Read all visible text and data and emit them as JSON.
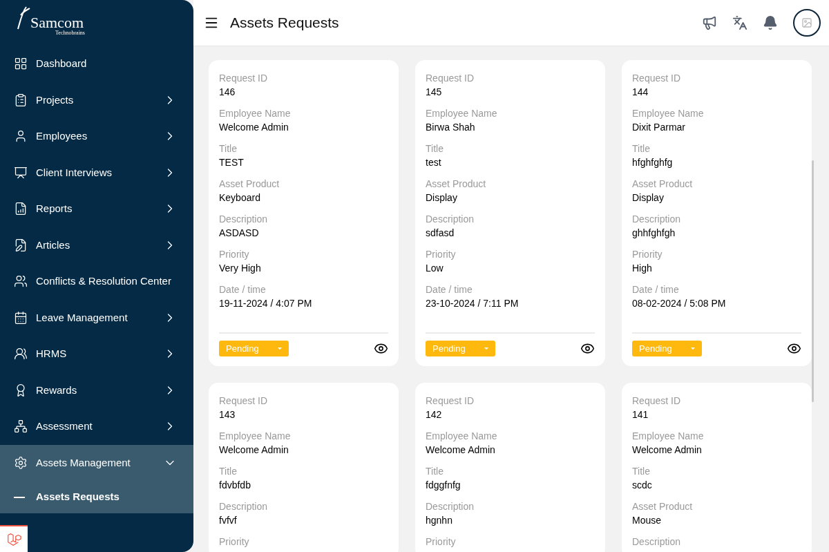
{
  "logo": {
    "name": "Samcom",
    "tagline": "Technobrains"
  },
  "sidebar": {
    "items": [
      {
        "label": "Dashboard",
        "kind": "link"
      },
      {
        "label": "Projects",
        "kind": "group",
        "expanded": false
      },
      {
        "label": "Employees",
        "kind": "group",
        "expanded": false
      },
      {
        "label": "Client Interviews",
        "kind": "group",
        "expanded": false
      },
      {
        "label": "Reports",
        "kind": "group",
        "expanded": false
      },
      {
        "label": "Articles",
        "kind": "group",
        "expanded": false
      },
      {
        "label": "Conflicts & Resolution Center",
        "kind": "link"
      },
      {
        "label": "Leave Management",
        "kind": "group",
        "expanded": false
      },
      {
        "label": "HRMS",
        "kind": "group",
        "expanded": false
      },
      {
        "label": "Rewards",
        "kind": "group",
        "expanded": false
      },
      {
        "label": "Assessment",
        "kind": "group",
        "expanded": false
      },
      {
        "label": "Assets Management",
        "kind": "group",
        "expanded": true,
        "children": [
          {
            "label": "Assets Requests",
            "selected": true
          }
        ]
      }
    ]
  },
  "header": {
    "title": "Assets Requests"
  },
  "cards": [
    {
      "fields": [
        {
          "label": "Request ID",
          "value": "146"
        },
        {
          "label": "Employee Name",
          "value": "Welcome Admin"
        },
        {
          "label": "Title",
          "value": "TEST"
        },
        {
          "label": "Asset Product",
          "value": "Keyboard"
        },
        {
          "label": "Description",
          "value": "ASDASD"
        },
        {
          "label": "Priority",
          "value": "Very High"
        },
        {
          "label": "Date / time",
          "value": "19-11-2024 / 4:07 PM"
        }
      ],
      "status": "Pending"
    },
    {
      "fields": [
        {
          "label": "Request ID",
          "value": "145"
        },
        {
          "label": "Employee Name",
          "value": "Birwa Shah"
        },
        {
          "label": "Title",
          "value": "test"
        },
        {
          "label": "Asset Product",
          "value": "Display"
        },
        {
          "label": "Description",
          "value": "sdfasd"
        },
        {
          "label": "Priority",
          "value": "Low"
        },
        {
          "label": "Date / time",
          "value": "23-10-2024 / 7:11 PM"
        }
      ],
      "status": "Pending"
    },
    {
      "fields": [
        {
          "label": "Request ID",
          "value": "144"
        },
        {
          "label": "Employee Name",
          "value": "Dixit Parmar"
        },
        {
          "label": "Title",
          "value": "hfghfghfg"
        },
        {
          "label": "Asset Product",
          "value": "Display"
        },
        {
          "label": "Description",
          "value": "ghhfghfgh"
        },
        {
          "label": "Priority",
          "value": "High"
        },
        {
          "label": "Date / time",
          "value": "08-02-2024 / 5:08 PM"
        }
      ],
      "status": "Pending"
    },
    {
      "fields": [
        {
          "label": "Request ID",
          "value": "143"
        },
        {
          "label": "Employee Name",
          "value": "Welcome Admin"
        },
        {
          "label": "Title",
          "value": "fdvbfdb"
        },
        {
          "label": "Description",
          "value": "fvfvf"
        },
        {
          "label": "Priority"
        }
      ]
    },
    {
      "fields": [
        {
          "label": "Request ID",
          "value": "142"
        },
        {
          "label": "Employee Name",
          "value": "Welcome Admin"
        },
        {
          "label": "Title",
          "value": "fdggfnfg"
        },
        {
          "label": "Description",
          "value": "hgnhn"
        },
        {
          "label": "Priority"
        }
      ]
    },
    {
      "fields": [
        {
          "label": "Request ID",
          "value": "141"
        },
        {
          "label": "Employee Name",
          "value": "Welcome Admin"
        },
        {
          "label": "Title",
          "value": "scdc"
        },
        {
          "label": "Asset Product",
          "value": "Mouse"
        },
        {
          "label": "Description"
        }
      ]
    }
  ]
}
